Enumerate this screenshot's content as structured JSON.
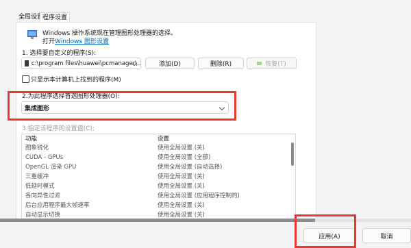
{
  "tabs": [
    {
      "label": "全局设置"
    },
    {
      "label": "程序设置"
    }
  ],
  "info": {
    "text": "Windows 操作系统现在管理图形处理器的选择。",
    "open_prefix": "打开",
    "link": "Windows 图形设置"
  },
  "step1": {
    "label": "1. 选择要自定义的程序(S):",
    "program_value": "c:\\program files\\huawei\\pcmanager\\...",
    "add_button": "添加(D)",
    "delete_button": "删除(R)",
    "restore_button": "恢复(T)"
  },
  "checkbox": {
    "label": "只显示本计算机上找到的程序(M)",
    "checked": false
  },
  "step2": {
    "label": "2.为此程序选择首选图形处理器(O):",
    "value": "集成图形"
  },
  "step3": {
    "label": "3.指定该程序的设置值(C):"
  },
  "table": {
    "headers": [
      "功能",
      "设置"
    ],
    "rows": [
      [
        "图象锐化",
        "使用全局设置 (关)"
      ],
      [
        "CUDA - GPUs",
        "使用全局设置 (全部)"
      ],
      [
        "OpenGL 渲染 GPU",
        "使用全局设置 (自动选择)"
      ],
      [
        "三重缓冲",
        "使用全局设置 (关)"
      ],
      [
        "低延时模式",
        "使用全局设置 (关)"
      ],
      [
        "各向异性过滤",
        "使用全局设置 (应用程序控制的)"
      ],
      [
        "后台应用程序最大帧速率",
        "使用全局设置 (关)"
      ],
      [
        "自动显示切换",
        "使用全局设置 (关)"
      ]
    ]
  },
  "footer": {
    "apply_button": "应用(A)",
    "cancel_button": "取消"
  },
  "colors": {
    "highlight": "#e53935",
    "link": "#0063b1",
    "accent_icon": "#76b900"
  }
}
